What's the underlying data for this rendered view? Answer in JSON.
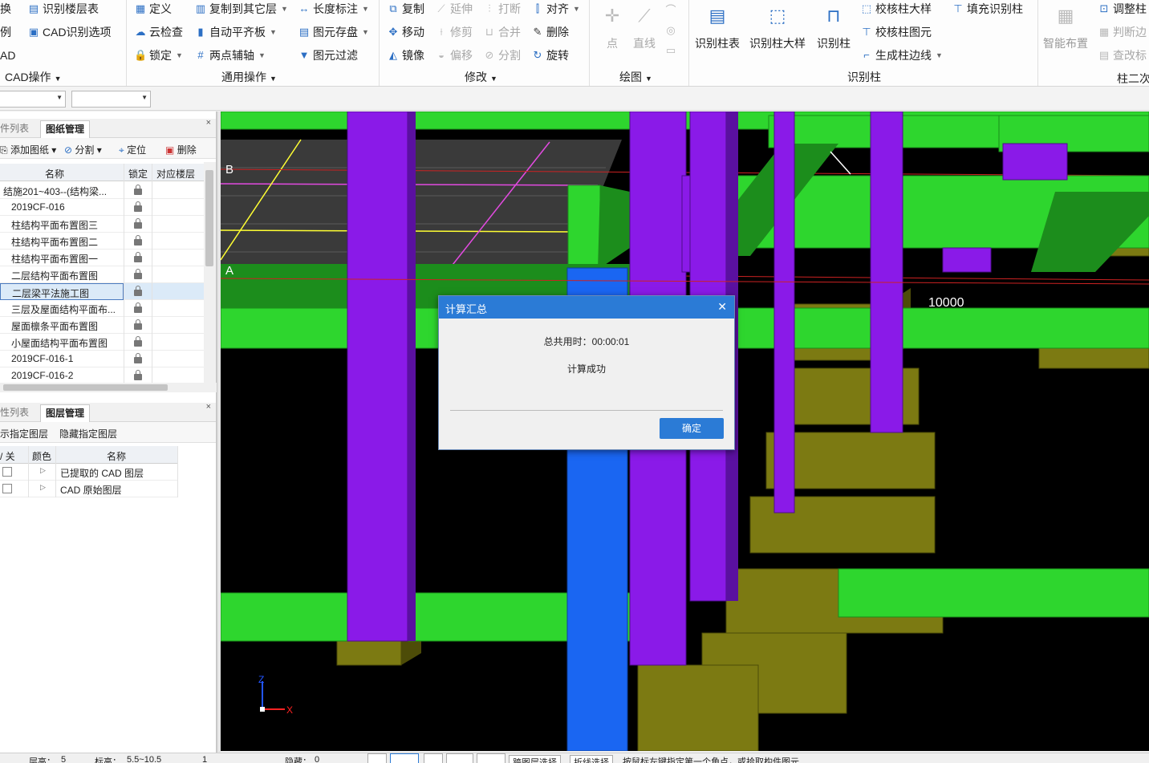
{
  "ribbon": {
    "col1": {
      "items": [
        "换",
        "例",
        "AD"
      ],
      "group": "CAD操作"
    },
    "col2": {
      "items": [
        "识别楼层表",
        "CAD识别选项"
      ]
    },
    "col3": {
      "items": [
        "定义",
        "云检查",
        "锁定"
      ]
    },
    "col4": {
      "items": [
        "复制到其它层",
        "自动平齐板",
        "两点辅轴"
      ],
      "group": "通用操作"
    },
    "col5": {
      "items": [
        "长度标注",
        "图元存盘",
        "图元过滤"
      ]
    },
    "col6": {
      "items": [
        "复制",
        "移动",
        "镜像"
      ]
    },
    "col7": {
      "items": [
        "延伸",
        "修剪",
        "偏移"
      ]
    },
    "col8": {
      "items": [
        "打断",
        "合并",
        "分割"
      ],
      "group": "修改"
    },
    "col9": {
      "items": [
        "对齐",
        "删除",
        "旋转"
      ]
    },
    "draw": {
      "items": [
        "点",
        "直线"
      ],
      "group": "绘图"
    },
    "col_big": {
      "items": [
        "识别柱表",
        "识别柱大样",
        "识别柱"
      ]
    },
    "col10": {
      "items": [
        "校核柱大样",
        "校核柱图元",
        "生成柱边线"
      ],
      "group": "识别柱"
    },
    "col11": {
      "items": [
        "填充识别柱"
      ]
    },
    "col12": {
      "items": [
        "智能布置"
      ]
    },
    "col13": {
      "items": [
        "调整柱",
        "判断边",
        "查改标"
      ],
      "group": "柱二次"
    }
  },
  "drawings_panel": {
    "tabs": [
      "件列表",
      "图纸管理"
    ],
    "toolbar": [
      "添加图纸",
      "分割",
      "定位",
      "删除"
    ],
    "columns": [
      "名称",
      "锁定",
      "对应楼层"
    ],
    "rows": [
      "结施201~403--(结构梁...",
      "2019CF-016",
      "柱结构平面布置图三",
      "柱结构平面布置图二",
      "柱结构平面布置图一",
      "二层结构平面布置图",
      "二层梁平法施工图",
      "三层及屋面结构平面布...",
      "屋面檩条平面布置图",
      "小屋面结构平面布置图",
      "2019CF-016-1",
      "2019CF-016-2"
    ]
  },
  "layers_panel": {
    "tabs": [
      "性列表",
      "图层管理"
    ],
    "toolbar": [
      "示指定图层",
      "隐藏指定图层"
    ],
    "columns": [
      "/ 关",
      "颜色",
      "名称"
    ],
    "rows": [
      "已提取的 CAD 图层",
      "CAD 原始图层"
    ]
  },
  "viewport": {
    "axis_labels": [
      "B",
      "A"
    ],
    "dimension": "10000",
    "axis_x": "X",
    "axis_z": "Z"
  },
  "dialog": {
    "title": "计算汇总",
    "time_label": "总共用时：00:00:01",
    "result": "计算成功",
    "ok": "确定"
  },
  "statusbar": [
    "层高：",
    "5",
    "标高：",
    "5.5~10.5",
    "1",
    "隐藏：",
    "0",
    "跨图层选择",
    "折线选择",
    "按鼠标左键指定第一个角点，或拾取构件图元"
  ]
}
